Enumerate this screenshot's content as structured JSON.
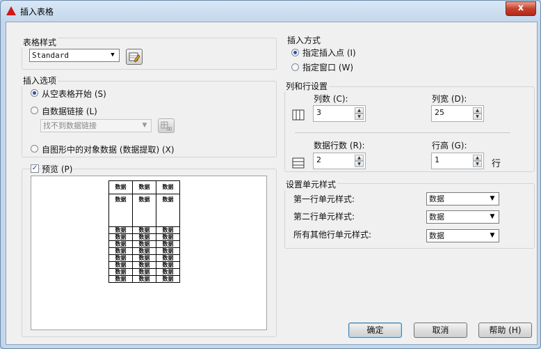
{
  "window": {
    "title": "插入表格",
    "close_label": "x"
  },
  "table_style": {
    "group_title": "表格样式",
    "selected": "Standard"
  },
  "insert_options": {
    "group_title": "插入选项",
    "from_empty": "从空表格开始 (S)",
    "from_data_link": "自数据链接 (L)",
    "data_link_value": "找不到数据链接",
    "from_drawing": "自图形中的对象数据 (数据提取) (X)"
  },
  "preview": {
    "label": "预览 (P)",
    "checked": true,
    "cell_text": "数据",
    "columns": 3,
    "header_rows": 2,
    "data_rows": 8
  },
  "insert_method": {
    "group_title": "插入方式",
    "specify_point": "指定插入点 (I)",
    "specify_window": "指定窗口 (W)"
  },
  "col_row": {
    "group_title": "列和行设置",
    "columns_label": "列数 (C):",
    "columns_value": "3",
    "col_width_label": "列宽 (D):",
    "col_width_value": "25",
    "data_rows_label": "数据行数 (R):",
    "data_rows_value": "2",
    "row_height_label": "行高 (G):",
    "row_height_value": "1",
    "row_unit": "行"
  },
  "cell_styles": {
    "group_title": "设置单元样式",
    "first_row_label": "第一行单元样式:",
    "first_row_value": "数据",
    "second_row_label": "第二行单元样式:",
    "second_row_value": "数据",
    "other_rows_label": "所有其他行单元样式:",
    "other_rows_value": "数据"
  },
  "buttons": {
    "ok": "确定",
    "cancel": "取消",
    "help": "帮助 (H)"
  }
}
